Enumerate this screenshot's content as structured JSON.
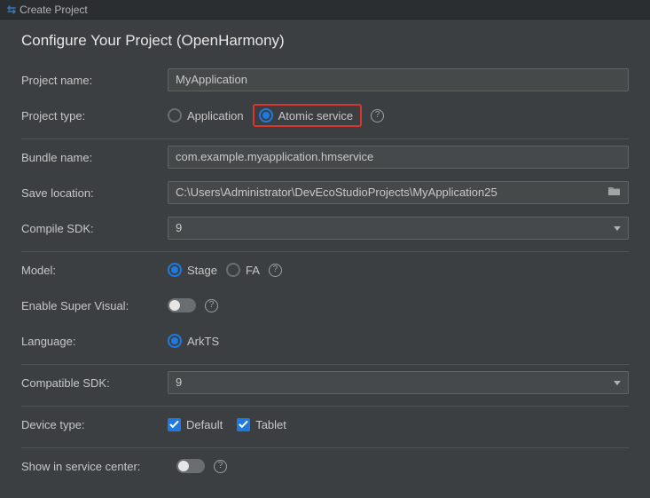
{
  "window": {
    "title": "Create Project"
  },
  "heading": "Configure Your Project (OpenHarmony)",
  "labels": {
    "project_name": "Project name:",
    "project_type": "Project type:",
    "bundle_name": "Bundle name:",
    "save_location": "Save location:",
    "compile_sdk": "Compile SDK:",
    "model": "Model:",
    "enable_super_visual": "Enable Super Visual:",
    "language": "Language:",
    "compatible_sdk": "Compatible SDK:",
    "device_type": "Device type:",
    "show_in_service_center": "Show in service center:"
  },
  "fields": {
    "project_name": "MyApplication",
    "bundle_name": "com.example.myapplication.hmservice",
    "save_location": "C:\\Users\\Administrator\\DevEcoStudioProjects\\MyApplication25",
    "compile_sdk": "9",
    "compatible_sdk": "9"
  },
  "project_type": {
    "options": {
      "application": "Application",
      "atomic_service": "Atomic service"
    },
    "selected": "atomic_service"
  },
  "model": {
    "options": {
      "stage": "Stage",
      "fa": "FA"
    },
    "selected": "stage"
  },
  "language": {
    "options": {
      "arkts": "ArkTS"
    },
    "selected": "arkts"
  },
  "device_type": {
    "default": {
      "label": "Default",
      "checked": true
    },
    "tablet": {
      "label": "Tablet",
      "checked": true
    }
  },
  "toggles": {
    "enable_super_visual": false,
    "show_in_service_center": false
  },
  "glyphs": {
    "help": "?"
  }
}
